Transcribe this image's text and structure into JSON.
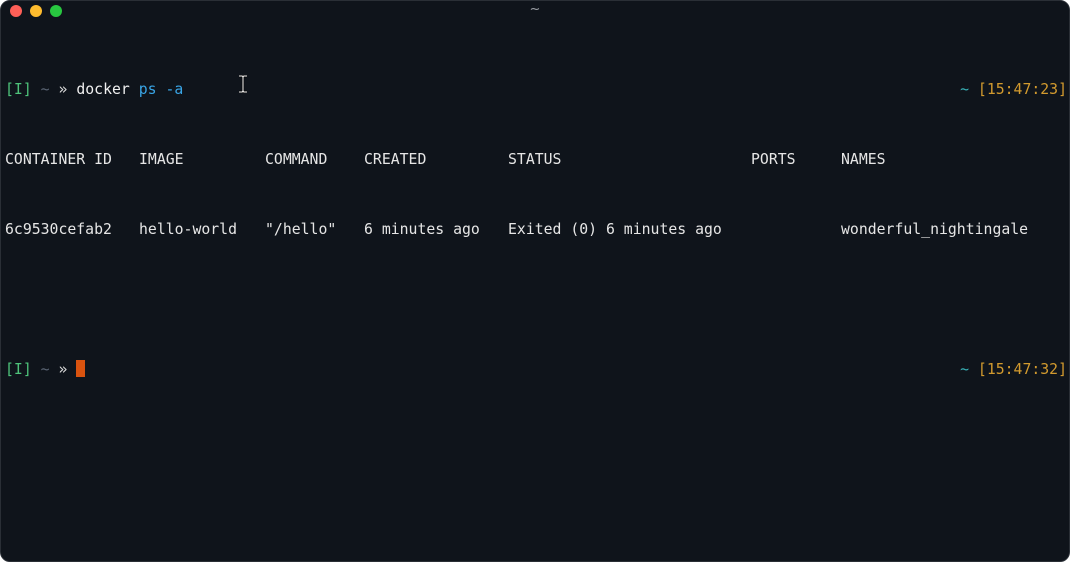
{
  "window": {
    "title": "~"
  },
  "prompt": {
    "mode": "[I]",
    "cwd": "~",
    "arrow": "»",
    "right_tilde": "~"
  },
  "line1": {
    "command": "docker",
    "args": "ps -a",
    "time": "[15:47:23]"
  },
  "table": {
    "headers": [
      "CONTAINER ID",
      "IMAGE",
      "COMMAND",
      "CREATED",
      "STATUS",
      "PORTS",
      "NAMES"
    ],
    "row": [
      "6c9530cefab2",
      "hello-world",
      "\"/hello\"",
      "6 minutes ago",
      "Exited (0) 6 minutes ago",
      "",
      "wonderful_nightingale"
    ]
  },
  "line2": {
    "time": "[15:47:32]"
  },
  "colors": {
    "background": "#0f141b",
    "prompt_green": "#4ec27a",
    "arg_blue": "#39a5e6",
    "time_orange": "#d29a2e",
    "cursor": "#d9530f"
  }
}
